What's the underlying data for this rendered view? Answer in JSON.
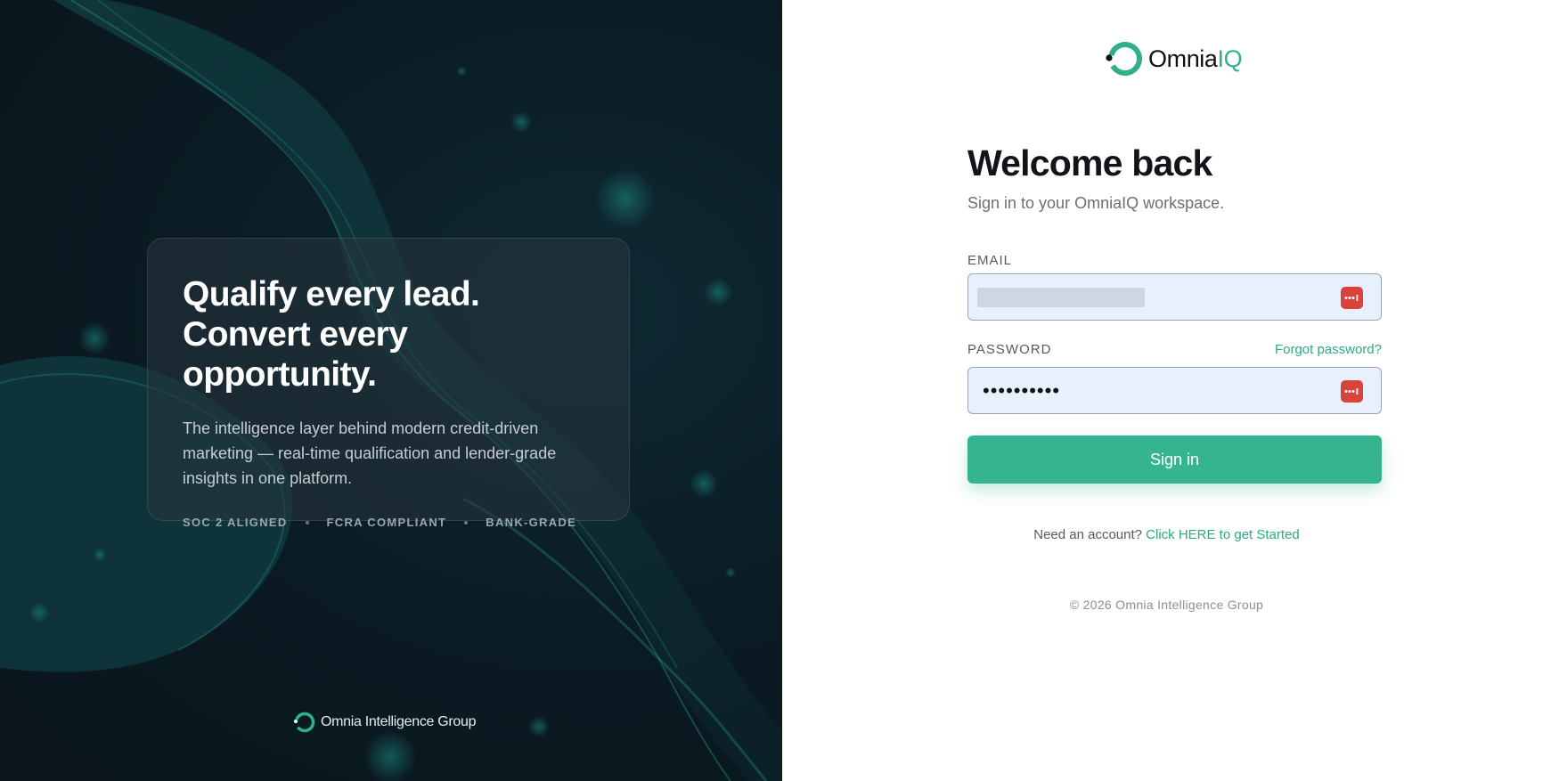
{
  "hero": {
    "title_line1": "Qualify every lead.",
    "title_line2": "Convert every opportunity.",
    "description": "The intelligence layer behind modern credit-driven marketing — real-time qualification and lender-grade insights in one platform.",
    "badges": [
      "SOC 2 ALIGNED",
      "FCRA COMPLIANT",
      "BANK-GRADE"
    ]
  },
  "left_footer": {
    "brand": "Omnia Intelligence Group"
  },
  "logo": {
    "text_main": "Omnia",
    "text_accent": "IQ"
  },
  "form": {
    "heading": "Welcome back",
    "subheading": "Sign in to your OmniaIQ workspace.",
    "email_label": "EMAIL",
    "password_label": "PASSWORD",
    "forgot_label": "Forgot password?",
    "password_value": "••••••••••",
    "submit_label": "Sign in"
  },
  "signup": {
    "prompt": "Need an account?",
    "link": "Click HERE to get Started"
  },
  "copyright": "© 2026 Omnia Intelligence Group",
  "colors": {
    "accent": "#36b38f",
    "left_bg": "#0b1c24",
    "autofill_bg": "#e8f0fe",
    "pm_icon": "#d8443c"
  }
}
